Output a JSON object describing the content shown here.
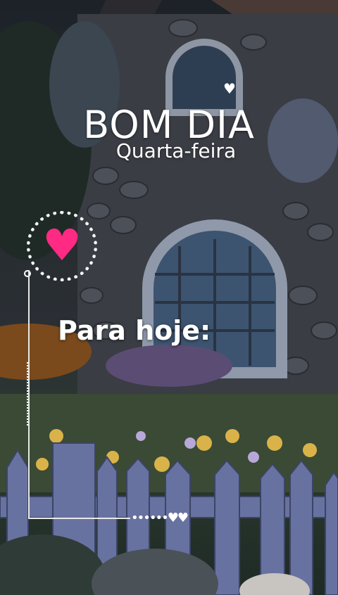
{
  "greeting": {
    "title": "BOM DIA",
    "subtitle": "Quarta-feira",
    "list_heading": "Para hoje:"
  },
  "decor": {
    "heart_color": "#ff2a83",
    "small_heart_icon": "white-heart-icon",
    "badge_icon": "pink-heart-icon"
  }
}
